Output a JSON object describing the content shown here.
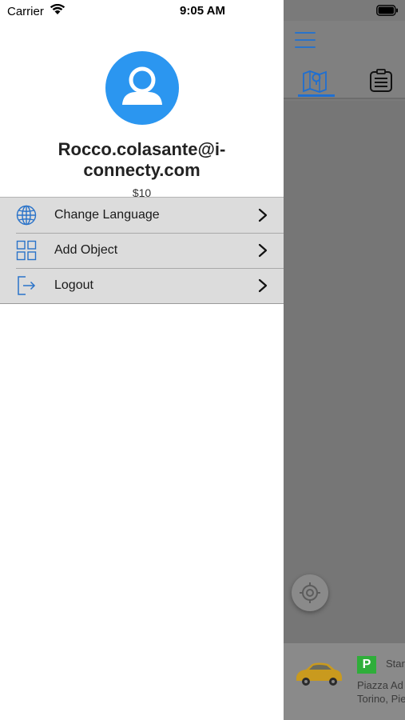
{
  "status_bar": {
    "carrier": "Carrier",
    "time": "9:05 AM",
    "icons": [
      "wifi-icon",
      "battery-icon"
    ]
  },
  "drawer": {
    "avatar_icon": "user-avatar-icon",
    "user_email": "Rocco.colasante@i-connecty.com",
    "balance": "$10",
    "menu": [
      {
        "label": "Change Language",
        "icon": "globe-icon"
      },
      {
        "label": "Add Object",
        "icon": "grid-icon"
      },
      {
        "label": "Logout",
        "icon": "logout-icon"
      }
    ]
  },
  "main_screen": {
    "tabs": [
      {
        "icon": "map-icon",
        "selected": true
      },
      {
        "icon": "list-icon",
        "selected": false
      }
    ],
    "bottom_card": {
      "badge": "P",
      "title": "Star",
      "address_line1": "Piazza Ad",
      "address_line2": "Torino, Pie"
    }
  },
  "colors": {
    "accent": "#2b96f0",
    "icon_blue": "#2a73c9",
    "overlay": "#7a7a7a",
    "menu_bg": "#dcdcdc",
    "parking_green": "#2fae3a"
  }
}
